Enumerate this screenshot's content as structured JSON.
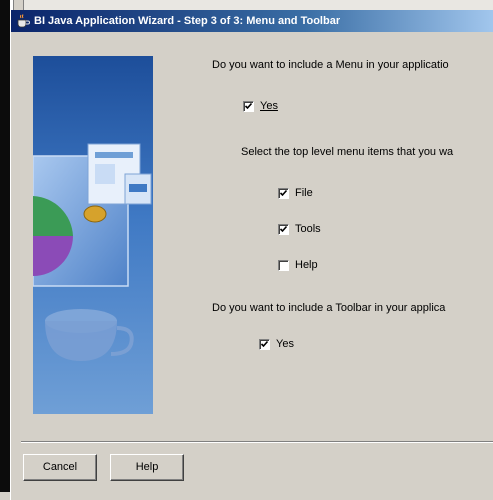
{
  "window": {
    "title": "BI Java Application Wizard - Step 3 of 3: Menu and Toolbar"
  },
  "menu_section": {
    "question": "Do you want to include a Menu in your applicatio",
    "include_menu": {
      "label": "Yes",
      "checked": true
    },
    "select_prompt": "Select the top level menu items that you wa",
    "items": [
      {
        "label": "File",
        "checked": true
      },
      {
        "label": "Tools",
        "checked": true
      },
      {
        "label": "Help",
        "checked": false
      }
    ]
  },
  "toolbar_section": {
    "question": "Do you want to include a Toolbar in your applica",
    "include_toolbar": {
      "label": "Yes",
      "checked": true
    }
  },
  "buttons": {
    "cancel": "Cancel",
    "help": "Help"
  },
  "colors": {
    "titlebar_start": "#0a246a",
    "titlebar_end": "#a6caf0",
    "dialog_bg": "#d4d0c8"
  }
}
